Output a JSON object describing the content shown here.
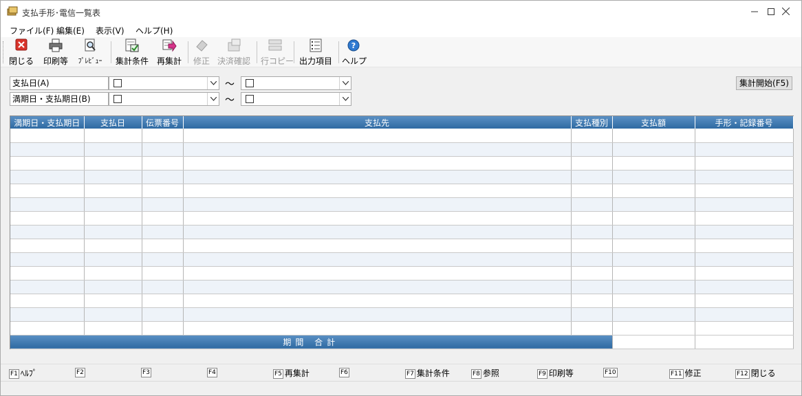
{
  "window": {
    "title": "支払手形･電信一覧表"
  },
  "menu": [
    {
      "label": "ファイル(F)"
    },
    {
      "label": "編集(E)"
    },
    {
      "label": "表示(V)"
    },
    {
      "label": "ヘルプ(H)"
    }
  ],
  "toolbar": {
    "close": "閉じる",
    "print": "印刷等",
    "preview": "ﾌﾟﾚﾋﾞｭｰ",
    "conditions": "集計条件",
    "recalc": "再集計",
    "edit": "修正",
    "settle": "決済確認",
    "rowcopy": "行コピー",
    "output": "出力項目",
    "help": "ヘルプ"
  },
  "filters": {
    "payment_date_label": "支払日(A)",
    "due_date_label": "満期日・支払期日(B)",
    "tilde": "〜",
    "start_button": "集計開始(F5)"
  },
  "grid": {
    "columns": [
      "満期日・支払期日",
      "支払日",
      "伝票番号",
      "支払先",
      "支払種別",
      "支払額",
      "手形・記録番号"
    ],
    "total_label": "期間 合計"
  },
  "fkeys": [
    {
      "key": "F1",
      "label": "ﾍﾙﾌﾟ"
    },
    {
      "key": "F2",
      "label": ""
    },
    {
      "key": "F3",
      "label": ""
    },
    {
      "key": "F4",
      "label": ""
    },
    {
      "key": "F5",
      "label": "再集計"
    },
    {
      "key": "F6",
      "label": ""
    },
    {
      "key": "F7",
      "label": "集計条件"
    },
    {
      "key": "F8",
      "label": "参照"
    },
    {
      "key": "F9",
      "label": "印刷等"
    },
    {
      "key": "F10",
      "label": ""
    },
    {
      "key": "F11",
      "label": "修正"
    },
    {
      "key": "F12",
      "label": "閉じる"
    }
  ],
  "colors": {
    "header_blue": "#3a73a8",
    "row_alt": "#eef3f9"
  }
}
